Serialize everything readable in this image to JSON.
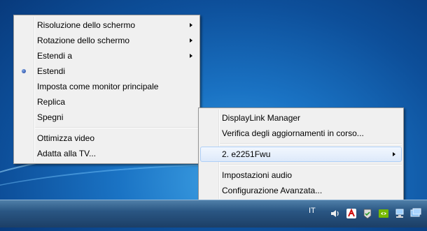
{
  "menu_main": {
    "items": [
      {
        "label": "Risoluzione dello schermo",
        "submenu": true
      },
      {
        "label": "Rotazione dello schermo",
        "submenu": true
      },
      {
        "label": "Estendi a",
        "submenu": true
      },
      {
        "label": "Estendi",
        "selected": true
      },
      {
        "label": "Imposta come monitor principale"
      },
      {
        "label": "Replica"
      },
      {
        "label": "Spegni"
      },
      {
        "label": "Ottimizza video"
      },
      {
        "label": "Adatta alla TV..."
      }
    ]
  },
  "menu_sub": {
    "items": [
      {
        "label": "DisplayLink Manager"
      },
      {
        "label": "Verifica degli aggiornamenti in corso..."
      },
      {
        "label": "2. e2251Fwu",
        "submenu": true,
        "highlighted": true
      },
      {
        "label": "Impostazioni audio"
      },
      {
        "label": "Configurazione Avanzata..."
      }
    ]
  },
  "taskbar": {
    "language": "IT",
    "tray_icons": [
      "speaker-icon",
      "antivirus-icon",
      "action-center-icon",
      "nvidia-icon",
      "network-icon",
      "displaylink-icon"
    ]
  },
  "colors": {
    "menu_bg": "#f0f0f0",
    "highlight": "#dde9fa",
    "desktop": "#1a73c4"
  }
}
